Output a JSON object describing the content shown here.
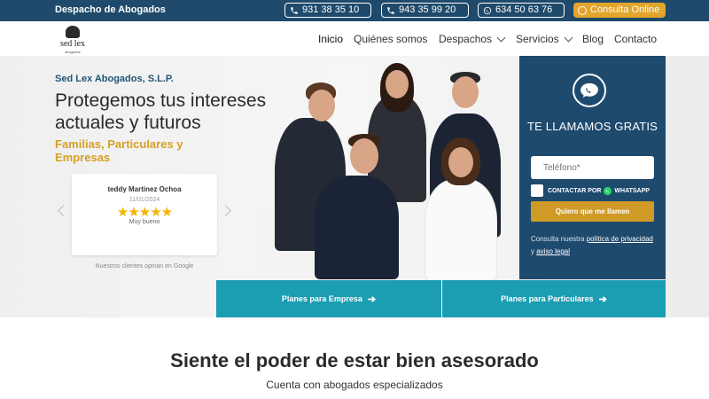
{
  "topbar": {
    "brand": "Despacho de Abogados",
    "phones": [
      {
        "label": "931 38 35 10",
        "icon": "phone-icon"
      },
      {
        "label": "943 35 99 20",
        "icon": "phone-icon"
      },
      {
        "label": "634 50 63 76",
        "icon": "whatsapp-icon"
      }
    ],
    "consulta_label": "Consulta Online",
    "colors": {
      "bar": "#1f4a6b",
      "consulta": "#e3a52a"
    }
  },
  "logo": {
    "name": "sed lex",
    "sub": "abogados"
  },
  "nav": {
    "items": [
      {
        "label": "Inicio",
        "active": true,
        "dropdown": false
      },
      {
        "label": "Quiénes somos",
        "active": false,
        "dropdown": false
      },
      {
        "label": "Despachos",
        "active": false,
        "dropdown": true
      },
      {
        "label": "Servicios",
        "active": false,
        "dropdown": true
      },
      {
        "label": "Blog",
        "active": false,
        "dropdown": false
      },
      {
        "label": "Contacto",
        "active": false,
        "dropdown": false
      }
    ]
  },
  "hero": {
    "firm": "Sed Lex Abogados, S.L.P.",
    "headline": "Protegemos tus intereses actuales y futuros",
    "tagline": "Familias, Particulares y Empresas",
    "review": {
      "author": "teddy Martinez Ochoa",
      "date": "11/01/2024",
      "stars": "★★★★★",
      "rating_text": "Muy bueno",
      "rating_value": 5
    },
    "google_note": "Nuestros clientes opinan en Google"
  },
  "callback": {
    "title": "TE LLAMAMOS GRATIS",
    "phone_placeholder": "Teléfono*",
    "whatsapp_label_prefix": "CONTACTAR POR",
    "whatsapp_label": "WHATSAPP",
    "submit_label": "Quiero que me llamen",
    "privacy_prefix": "Consulta nuestra",
    "privacy_link": "política de privacidad",
    "privacy_and": "y",
    "legal_link": "aviso legal",
    "colors": {
      "panel": "#1e4a6e",
      "submit": "#cf9b26"
    }
  },
  "plans": {
    "empresa": "Planes para Empresa",
    "particulares": "Planes para Particulares",
    "arrow": "➔",
    "color": "#1b9db2"
  },
  "section": {
    "title": "Siente el poder de estar bien asesorado",
    "subtitle": "Cuenta con abogados especializados"
  }
}
